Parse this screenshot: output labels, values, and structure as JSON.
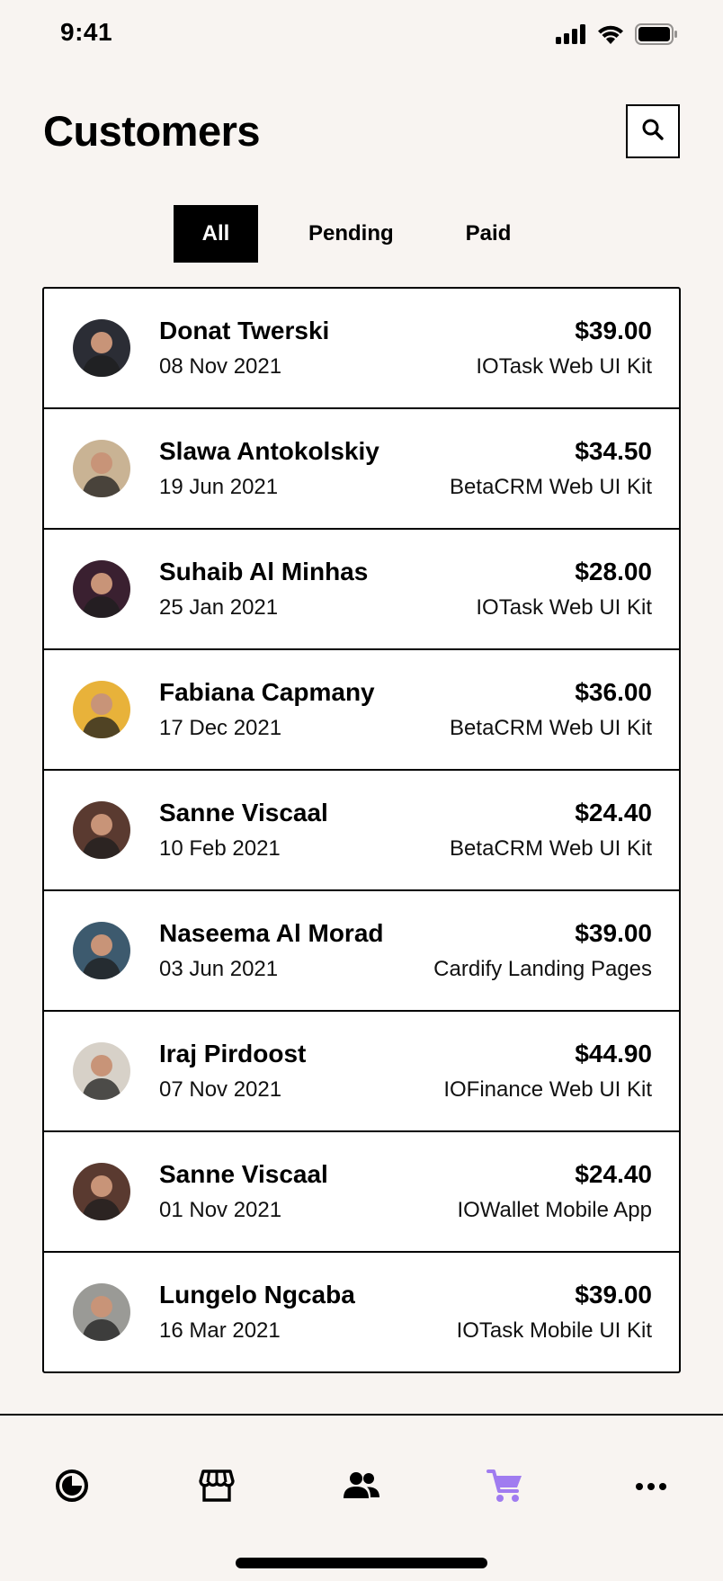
{
  "status_bar": {
    "time": "9:41"
  },
  "header": {
    "title": "Customers"
  },
  "tabs": [
    {
      "label": "All",
      "active": true
    },
    {
      "label": "Pending",
      "active": false
    },
    {
      "label": "Paid",
      "active": false
    }
  ],
  "customers": [
    {
      "name": "Donat Twerski",
      "date": "08 Nov 2021",
      "amount": "$39.00",
      "product": "IOTask Web UI Kit",
      "avatar_color": "#2b2d35"
    },
    {
      "name": "Slawa Antokolskiy",
      "date": "19 Jun 2021",
      "amount": "$34.50",
      "product": "BetaCRM Web UI Kit",
      "avatar_color": "#c9b394"
    },
    {
      "name": "Suhaib Al Minhas",
      "date": "25 Jan 2021",
      "amount": "$28.00",
      "product": "IOTask Web UI Kit",
      "avatar_color": "#3a2030"
    },
    {
      "name": "Fabiana Capmany",
      "date": "17 Dec 2021",
      "amount": "$36.00",
      "product": "BetaCRM Web UI Kit",
      "avatar_color": "#e8b23a"
    },
    {
      "name": "Sanne Viscaal",
      "date": "10 Feb 2021",
      "amount": "$24.40",
      "product": "BetaCRM Web UI Kit",
      "avatar_color": "#5a3a30"
    },
    {
      "name": "Naseema Al Morad",
      "date": "03 Jun 2021",
      "amount": "$39.00",
      "product": "Cardify Landing Pages",
      "avatar_color": "#3d5a6e"
    },
    {
      "name": "Iraj Pirdoost",
      "date": "07 Nov 2021",
      "amount": "$44.90",
      "product": "IOFinance Web UI Kit",
      "avatar_color": "#d7d1c8"
    },
    {
      "name": "Sanne Viscaal",
      "date": "01 Nov 2021",
      "amount": "$24.40",
      "product": "IOWallet Mobile App",
      "avatar_color": "#5a3a30"
    },
    {
      "name": "Lungelo Ngcaba",
      "date": "16 Mar 2021",
      "amount": "$39.00",
      "product": "IOTask Mobile UI Kit",
      "avatar_color": "#9a9a96"
    }
  ],
  "tabbar": [
    {
      "icon": "dashboard-icon",
      "active": false
    },
    {
      "icon": "store-icon",
      "active": false
    },
    {
      "icon": "customers-icon",
      "active": false
    },
    {
      "icon": "cart-icon",
      "active": true
    },
    {
      "icon": "more-icon",
      "active": false
    }
  ],
  "colors": {
    "background": "#f8f4f1",
    "accent": "#a07cf0",
    "text": "#000000"
  }
}
